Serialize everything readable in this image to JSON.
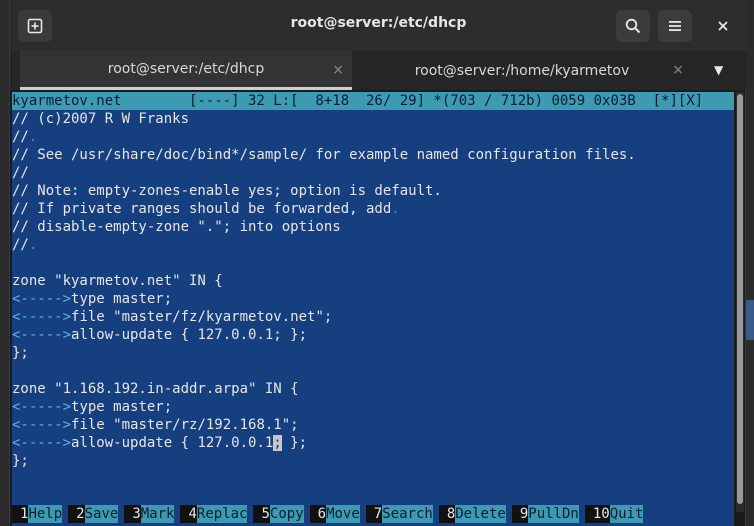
{
  "window": {
    "title": "root@server:/etc/dhcp",
    "new_tab_icon": "new-tab-icon",
    "search_icon": "search-icon",
    "menu_icon": "hamburger-menu-icon",
    "close_icon": "close-icon"
  },
  "tabs": [
    {
      "label": "root@server:/etc/dhcp",
      "close": "×"
    },
    {
      "label": "root@server:/home/kyarmetov",
      "close": "×"
    }
  ],
  "tab_dropdown": "▼",
  "editor": {
    "status": "kyarmetov.net        [----] 32 L:[  8+18  26/ 29] *(703 / 712b) 0059 0x03B  [*][X]",
    "lines": [
      "// (c)2007 R W Franks",
      "//",
      "// See /usr/share/doc/bind*/sample/ for example named configuration files.",
      "//",
      "// Note: empty-zones-enable yes; option is default.",
      "// If private ranges should be forwarded, add",
      "// disable-empty-zone \".\"; into options",
      "//",
      "",
      "zone \"kyarmetov.net\" IN {",
      "type master;",
      "file \"master/fz/kyarmetov.net\";",
      "allow-update { 127.0.0.1; };",
      "};",
      "",
      "zone \"1.168.192.in-addr.arpa\" IN {",
      "type master;",
      "file \"master/rz/192.168.1\";",
      "allow-update { 127.0.0.1; };",
      "};"
    ],
    "tab_marker": "<----->",
    "cursor_line_pre": "allow-update { 127.0.0.1",
    "cursor_char": ";",
    "cursor_line_post": " };"
  },
  "fkeys": [
    {
      "num": "1",
      "label": "Help  "
    },
    {
      "num": "2",
      "label": "Save  "
    },
    {
      "num": "3",
      "label": "Mark  "
    },
    {
      "num": "4",
      "label": "Replac"
    },
    {
      "num": "5",
      "label": "Copy  "
    },
    {
      "num": "6",
      "label": "Move  "
    },
    {
      "num": "7",
      "label": "Search"
    },
    {
      "num": "8",
      "label": "Delete"
    },
    {
      "num": "9",
      "label": "PullDn"
    },
    {
      "num": "10",
      "label": "Quit  "
    }
  ]
}
